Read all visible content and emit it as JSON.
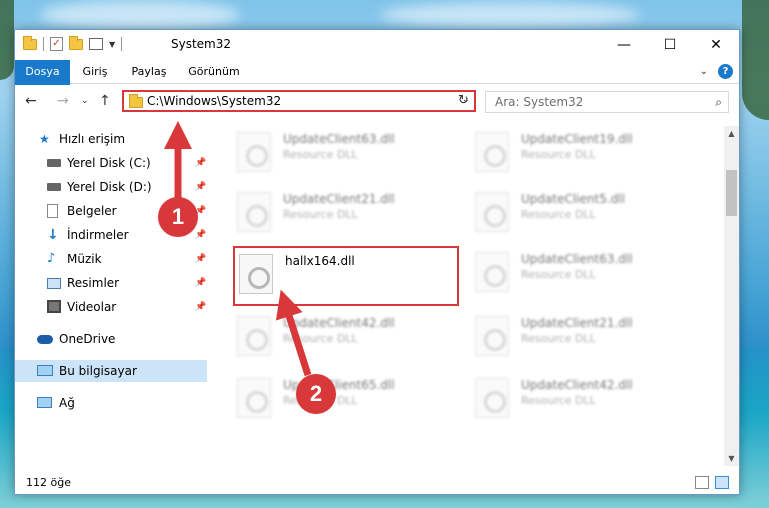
{
  "window": {
    "title": "System32",
    "controls": {
      "minimize": "—",
      "maximize": "☐",
      "close": "✕"
    }
  },
  "ribbon": {
    "tabs": [
      "Dosya",
      "Giriş",
      "Paylaş",
      "Görünüm"
    ]
  },
  "address": {
    "path": "C:\\Windows\\System32"
  },
  "search": {
    "placeholder": "Ara: System32"
  },
  "nav": {
    "items": [
      {
        "label": "Hızlı erişim",
        "icon": "star-icon"
      },
      {
        "label": "Yerel Disk (C:)",
        "icon": "drive-icon",
        "pinned": true
      },
      {
        "label": "Yerel Disk (D:)",
        "icon": "drive-icon",
        "pinned": true
      },
      {
        "label": "Belgeler",
        "icon": "documents-icon",
        "pinned": true
      },
      {
        "label": "İndirmeler",
        "icon": "download-icon",
        "pinned": true
      },
      {
        "label": "Müzik",
        "icon": "music-icon",
        "pinned": true
      },
      {
        "label": "Resimler",
        "icon": "pictures-icon",
        "pinned": true
      },
      {
        "label": "Videolar",
        "icon": "videos-icon",
        "pinned": true
      },
      {
        "label": "OneDrive",
        "icon": "cloud-icon"
      },
      {
        "label": "Bu bilgisayar",
        "icon": "computer-icon",
        "selected": true
      },
      {
        "label": "Ağ",
        "icon": "network-icon"
      }
    ]
  },
  "files": [
    {
      "name": "UpdateClient63.dll",
      "type": "Resource DLL"
    },
    {
      "name": "UpdateClient19.dll",
      "type": "Resource DLL"
    },
    {
      "name": "UpdateClient21.dll",
      "type": "Resource DLL"
    },
    {
      "name": "UpdateClient5.dll",
      "type": "Resource DLL"
    },
    {
      "name": "hallx164.dll",
      "type": ""
    },
    {
      "name": "UpdateClient63.dll",
      "type": "Resource DLL"
    },
    {
      "name": "UpdateClient42.dll",
      "type": "Resource DLL"
    },
    {
      "name": "UpdateClient21.dll",
      "type": "Resource DLL"
    },
    {
      "name": "UpdateClient65.dll",
      "type": "Resource DLL"
    },
    {
      "name": "UpdateClient42.dll",
      "type": "Resource DLL"
    }
  ],
  "status": {
    "count": "112 öğe"
  },
  "annotations": {
    "step1": "1",
    "step2": "2",
    "color": "#d9383a"
  }
}
